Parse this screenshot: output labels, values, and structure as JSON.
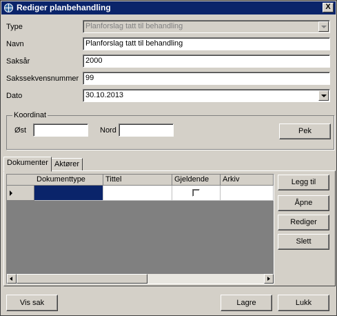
{
  "window": {
    "title": "Rediger planbehandling",
    "close_label": "X"
  },
  "form": {
    "type": {
      "label": "Type",
      "value": "Planforslag tatt til behandling"
    },
    "navn": {
      "label": "Navn",
      "value": "Planforslag tatt til behandling"
    },
    "saksar": {
      "label": "Saksår",
      "value": "2000"
    },
    "sakssekvensnummer": {
      "label": "Sakssekvensnummer",
      "value": "99"
    },
    "dato": {
      "label": "Dato",
      "value": "30.10.2013"
    }
  },
  "koordinat": {
    "group_label": "Koordinat",
    "ost_label": "Øst",
    "ost_value": "",
    "nord_label": "Nord",
    "nord_value": "",
    "pek_label": "Pek"
  },
  "tabs": [
    {
      "label": "Dokumenter",
      "active": true
    },
    {
      "label": "Aktører",
      "active": false
    }
  ],
  "grid": {
    "columns": [
      "Dokumenttype",
      "Tittel",
      "Gjeldende",
      "Arkiv"
    ],
    "rows": [
      {
        "dokumenttype": "",
        "tittel": "",
        "gjeldende": false,
        "arkiv": ""
      }
    ],
    "selection_color": "#0a246a"
  },
  "side_buttons": {
    "legg_til": "Legg til",
    "apne": "Åpne",
    "rediger": "Rediger",
    "slett": "Slett"
  },
  "bottom_buttons": {
    "vis_sak": "Vis sak",
    "lagre": "Lagre",
    "lukk": "Lukk"
  },
  "colors": {
    "titlebar": "#0a246a",
    "face": "#d4d0c8",
    "grid_empty": "#808080"
  },
  "icons": {
    "title": "globe-icon",
    "close": "close-icon",
    "dropdown": "chevron-down-icon",
    "row": "row-pointer-icon"
  }
}
